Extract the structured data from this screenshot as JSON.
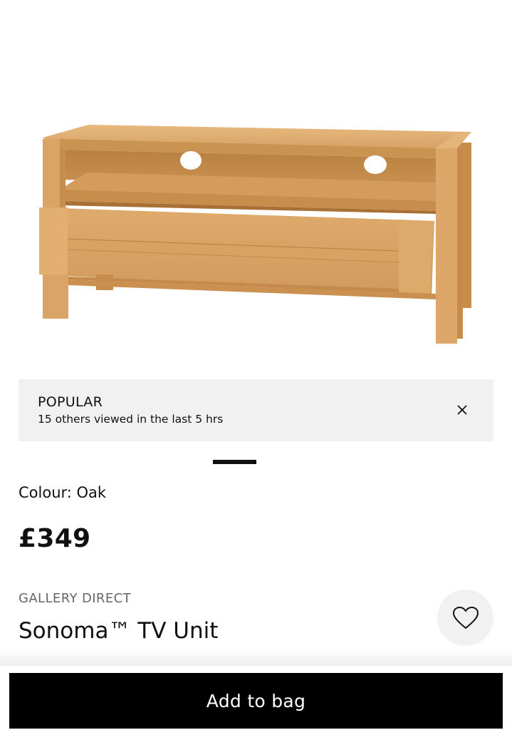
{
  "product_image": {
    "alt": "Sonoma TV Unit in oak"
  },
  "banner": {
    "title": "POPULAR",
    "subtitle": "15 others viewed in the last 5 hrs",
    "close_icon": "close-icon"
  },
  "carousel": {
    "active_index": 1,
    "total": 1
  },
  "colour": {
    "label": "Colour:",
    "value": "Oak"
  },
  "price": "£349",
  "brand": "GALLERY DIRECT",
  "product_name": "Sonoma™ TV Unit",
  "wishlist": {
    "icon": "heart-icon"
  },
  "cta": {
    "label": "Add to bag"
  },
  "colors": {
    "cta_bg": "#000000",
    "banner_bg": "#f1f1f1",
    "brand_text": "#666666",
    "wood": "#d9a564"
  }
}
